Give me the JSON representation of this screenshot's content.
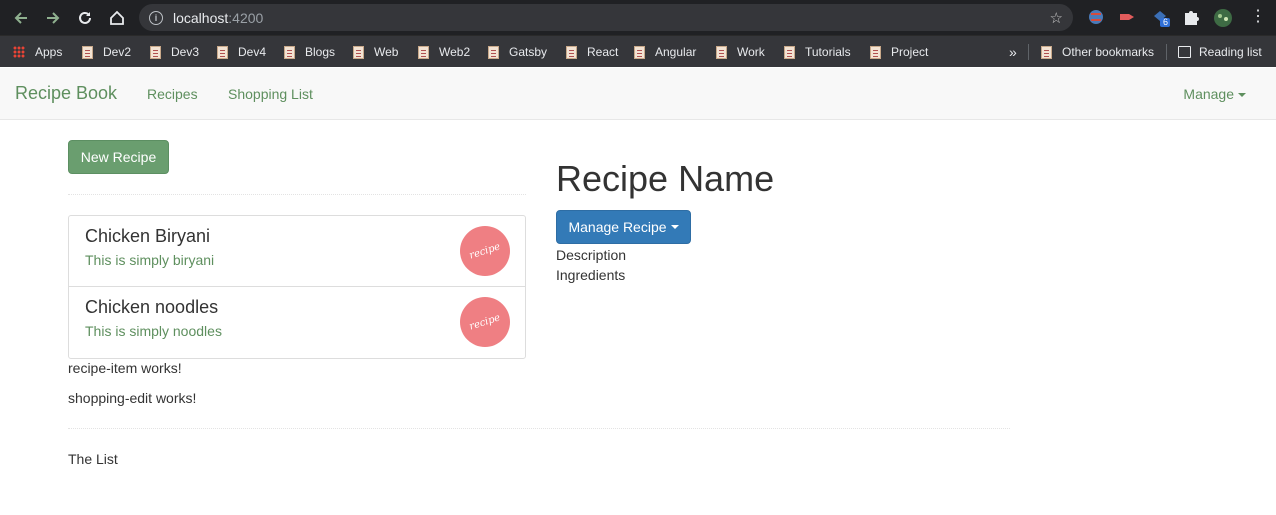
{
  "browser": {
    "url_host": "localhost",
    "url_port": ":4200",
    "bookmarks": [
      {
        "label": "Apps",
        "icon": "apps-grid-icon"
      },
      {
        "label": "Dev2",
        "icon": "bookmark-page-icon"
      },
      {
        "label": "Dev3",
        "icon": "bookmark-page-icon"
      },
      {
        "label": "Dev4",
        "icon": "bookmark-page-icon"
      },
      {
        "label": "Blogs",
        "icon": "bookmark-page-icon"
      },
      {
        "label": "Web",
        "icon": "bookmark-page-icon"
      },
      {
        "label": "Web2",
        "icon": "bookmark-page-icon"
      },
      {
        "label": "Gatsby",
        "icon": "bookmark-page-icon"
      },
      {
        "label": "React",
        "icon": "bookmark-page-icon"
      },
      {
        "label": "Angular",
        "icon": "bookmark-page-icon"
      },
      {
        "label": "Work",
        "icon": "bookmark-page-icon"
      },
      {
        "label": "Tutorials",
        "icon": "bookmark-page-icon"
      },
      {
        "label": "Project",
        "icon": "bookmark-page-icon"
      }
    ],
    "overflow_label": "»",
    "other_bookmarks": "Other bookmarks",
    "reading_list": "Reading list",
    "extension_badge": "6"
  },
  "navbar": {
    "brand": "Recipe Book",
    "links": [
      "Recipes",
      "Shopping List"
    ],
    "manage": "Manage"
  },
  "recipes": {
    "new_button": "New Recipe",
    "items": [
      {
        "name": "Chicken Biryani",
        "description": "This is simply biryani",
        "image_text": "recipe"
      },
      {
        "name": "Chicken noodles",
        "description": "This is simply noodles",
        "image_text": "recipe"
      }
    ],
    "recipe_item_msg": "recipe-item works!",
    "shopping_edit_msg": "shopping-edit works!",
    "the_list": "The List"
  },
  "detail": {
    "title": "Recipe Name",
    "manage_button": "Manage Recipe",
    "description_label": "Description",
    "ingredients_label": "Ingredients"
  },
  "colors": {
    "chrome_dark": "#202124",
    "link_green": "#5e8f5e",
    "success_green": "#6a9e6f",
    "primary_blue": "#337ab7",
    "recipe_pink": "#ef7f83"
  }
}
